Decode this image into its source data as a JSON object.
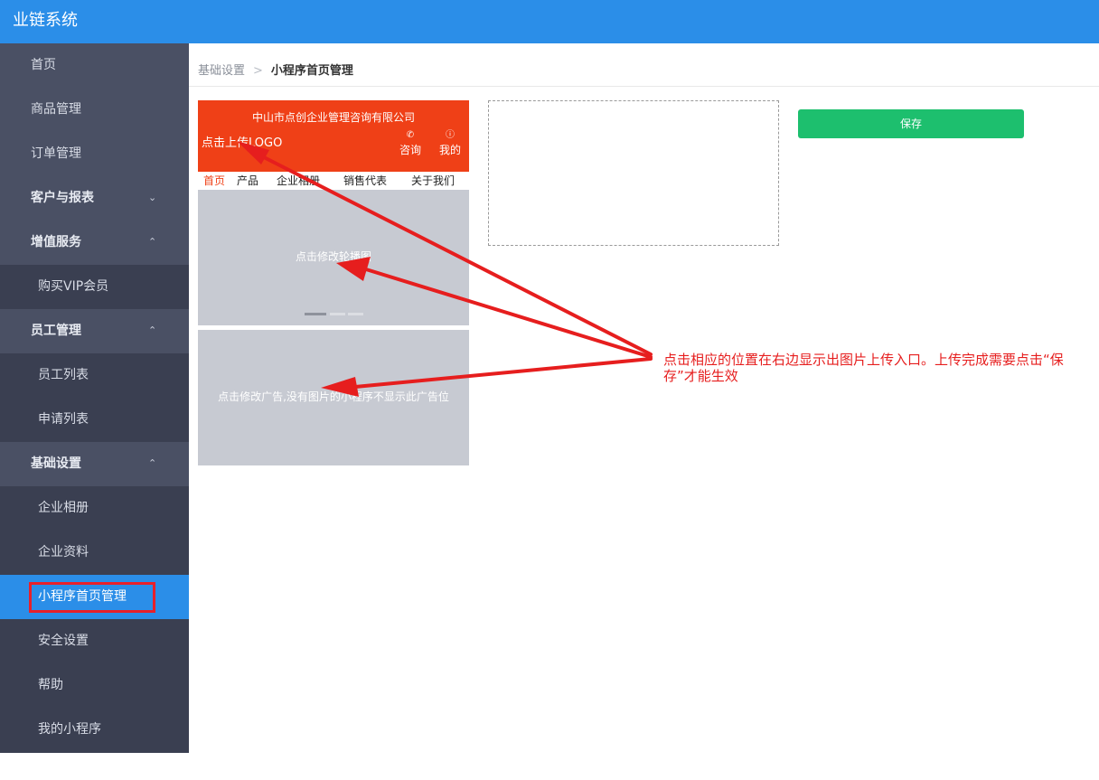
{
  "app": {
    "title": "业链系统",
    "header_color": "#2b8ee8"
  },
  "sidebar": {
    "items": [
      {
        "label": "首页"
      },
      {
        "label": "商品管理"
      },
      {
        "label": "订单管理"
      },
      {
        "label": "客户与报表",
        "chevron": "⌄"
      },
      {
        "label": "增值服务",
        "chevron": "⌃"
      },
      {
        "label": "购买VIP会员"
      },
      {
        "label": "员工管理",
        "chevron": "⌃"
      },
      {
        "label": "员工列表"
      },
      {
        "label": "申请列表"
      },
      {
        "label": "基础设置",
        "chevron": "⌃"
      },
      {
        "label": "企业相册"
      },
      {
        "label": "企业资料"
      },
      {
        "label": "小程序首页管理"
      },
      {
        "label": "安全设置"
      },
      {
        "label": "帮助"
      },
      {
        "label": "我的小程序"
      }
    ],
    "active_color": "#2b8ee8"
  },
  "breadcrumb": {
    "parent": "基础设置",
    "separator": ">",
    "current": "小程序首页管理"
  },
  "preview": {
    "company": "中山市点创企业管理咨询有限公司",
    "logo_hint": "点击上传LOGO",
    "consult": "咨询",
    "mine": "我的",
    "nav": [
      "首页",
      "产品",
      "企业相册",
      "销售代表",
      "关于我们"
    ],
    "banner_hint": "点击修改轮播图",
    "ad_hint": "点击修改广告,没有图片的小程序不显示此广告位",
    "header_color": "#ef4017"
  },
  "actions": {
    "save": "保存",
    "save_color": "#1dbf6e"
  },
  "annotation": {
    "text": "点击相应的位置在右边显示出图片上传入口。上传完成需要点击“保存”才能生效",
    "color": "#e61e1e"
  }
}
